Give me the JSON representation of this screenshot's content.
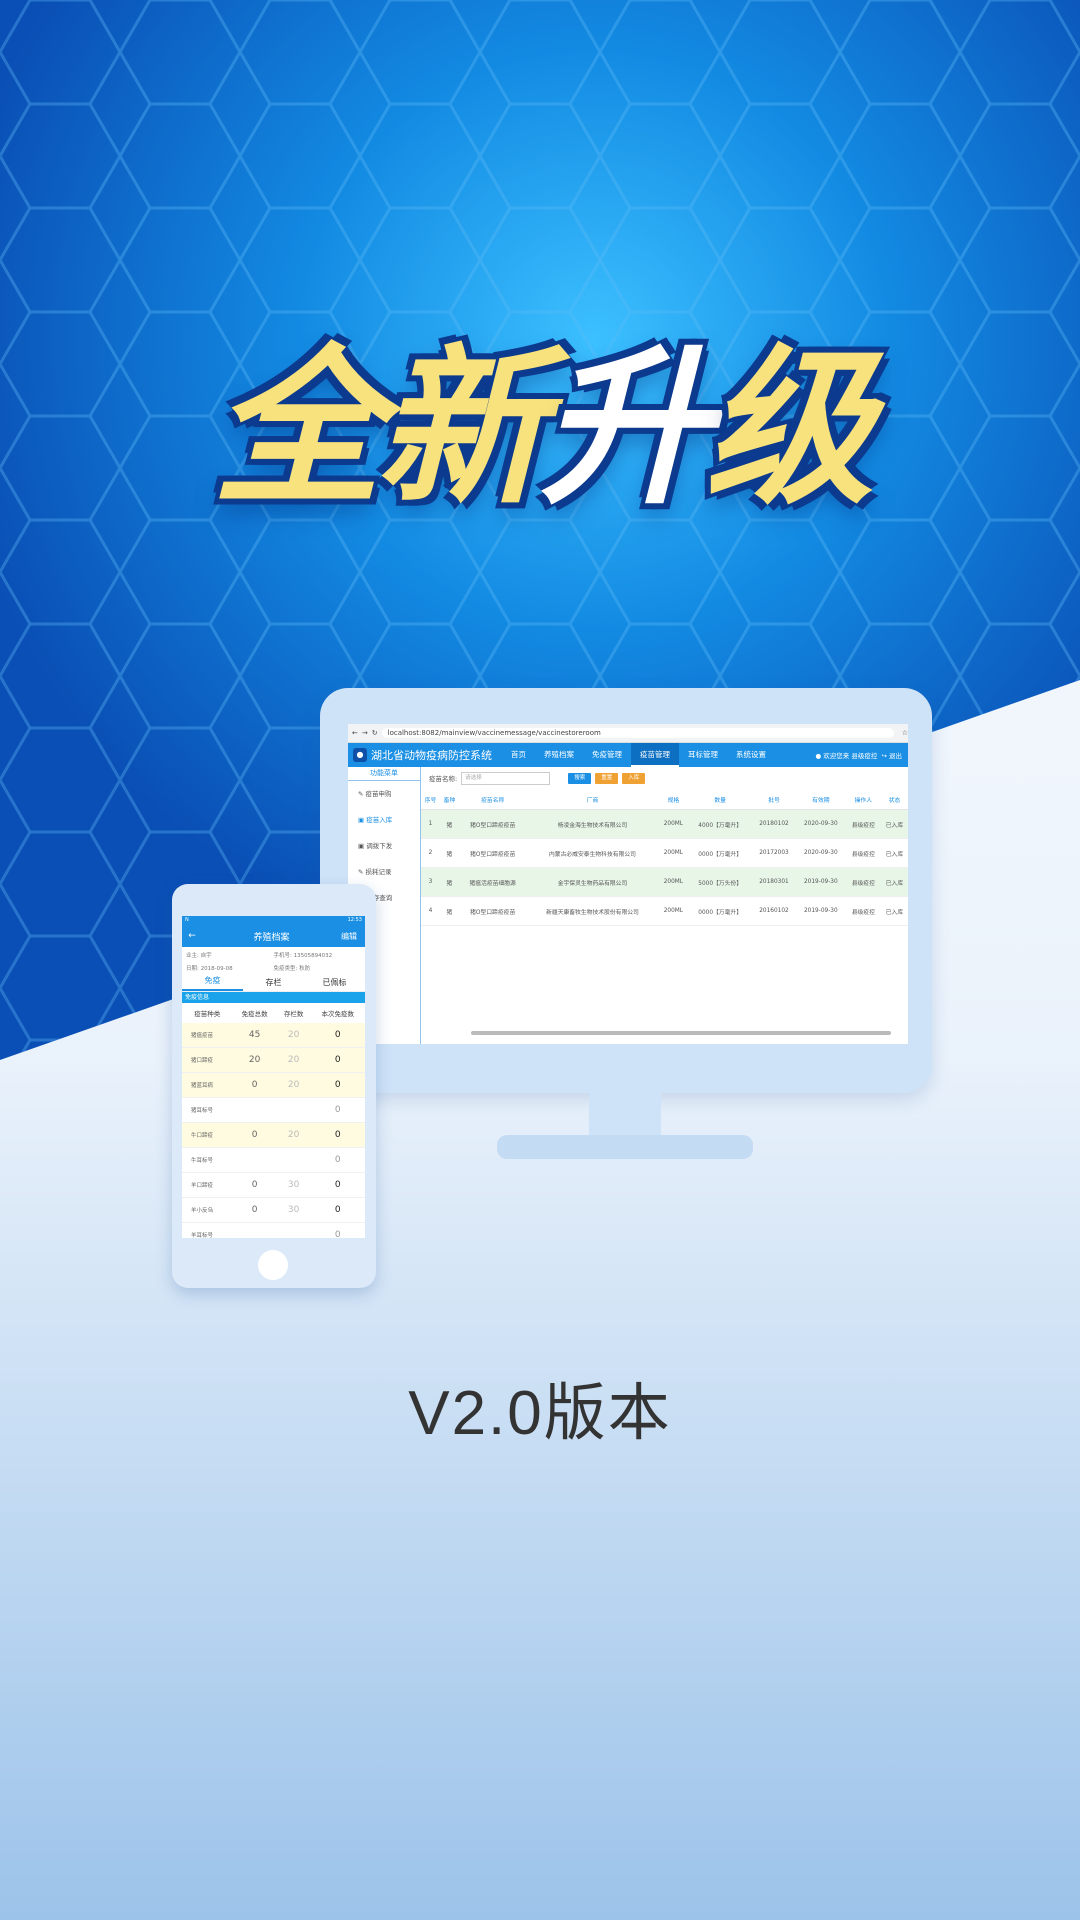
{
  "headline": {
    "part1": "全新",
    "part2": "升",
    "part3": "级"
  },
  "version_label": "V2.0版本",
  "colors": {
    "accent": "#1a8fe4",
    "gold": "#f7e27d"
  },
  "browser": {
    "url": "localhost:8082/mainview/vaccinemessage/vaccinestoreroom"
  },
  "desktop": {
    "system_name": "湖北省动物疫病防控系统",
    "nav": [
      "首页",
      "养殖档案",
      "免疫管理",
      "疫苗管理",
      "耳标管理",
      "系统设置"
    ],
    "user": "欢迎您来   县级疫控",
    "logout": "退出",
    "sidebar": {
      "header": "功能菜单",
      "items": [
        "疫苗申购",
        "疫苗入库",
        "调拨下发",
        "损耗记录",
        "库存查询"
      ]
    },
    "search": {
      "label": "疫苗名称:",
      "placeholder": "请选择",
      "buttons": [
        "搜索",
        "重置",
        "入库"
      ]
    },
    "table": {
      "headers": [
        "序号",
        "畜种",
        "疫苗名称",
        "厂商",
        "规格",
        "数量",
        "批号",
        "有效期",
        "操作人",
        "状态"
      ],
      "rows": [
        [
          "1",
          "猪",
          "猪O型口蹄疫疫苗",
          "杨凌金海生物技术有限公司",
          "200ML",
          "4000【万毫升】",
          "20180102",
          "2020-09-30",
          "县级疫控",
          "已入库"
        ],
        [
          "2",
          "猪",
          "猪O型口蹄疫疫苗",
          "内蒙古必威安泰生物科技有限公司",
          "200ML",
          "0000【万毫升】",
          "20172003",
          "2020-09-30",
          "县级疫控",
          "已入库"
        ],
        [
          "3",
          "猪",
          "猪瘟活疫苗细胞源",
          "金宇保灵生物药品有限公司",
          "200ML",
          "5000【万头份】",
          "20180301",
          "2019-09-30",
          "县级疫控",
          "已入库"
        ],
        [
          "4",
          "猪",
          "猪O型口蹄疫疫苗",
          "新疆天康畜牧生物技术股份有限公司",
          "200ML",
          "0000【万毫升】",
          "20160102",
          "2019-09-30",
          "县级疫控",
          "已入库"
        ]
      ]
    }
  },
  "mobile": {
    "status_left": "N",
    "status_right": "12:53",
    "title": "养殖档案",
    "edit": "编辑",
    "info": [
      "业主: 自宇",
      "手机号: 13505894032",
      "日期: 2018-09-08",
      "免疫类型: 秋防"
    ],
    "tabs": [
      "免疫",
      "存栏",
      "已佩标"
    ],
    "section": "免疫信息",
    "headers": [
      "疫苗种类",
      "免疫总数",
      "存栏数",
      "本次免疫数"
    ],
    "rows": [
      [
        "猪瘟疫苗",
        "45",
        "20",
        "0"
      ],
      [
        "猪口蹄疫",
        "20",
        "20",
        "0"
      ],
      [
        "猪蓝耳病",
        "0",
        "20",
        "0"
      ],
      [
        "猪耳标号",
        "",
        "",
        "0"
      ],
      [
        "牛口蹄疫",
        "0",
        "20",
        "0"
      ],
      [
        "牛耳标号",
        "",
        "",
        "0"
      ],
      [
        "羊口蹄疫",
        "0",
        "30",
        "0"
      ],
      [
        "羊小反刍",
        "0",
        "30",
        "0"
      ],
      [
        "羊耳标号",
        "",
        "",
        "0"
      ]
    ]
  }
}
